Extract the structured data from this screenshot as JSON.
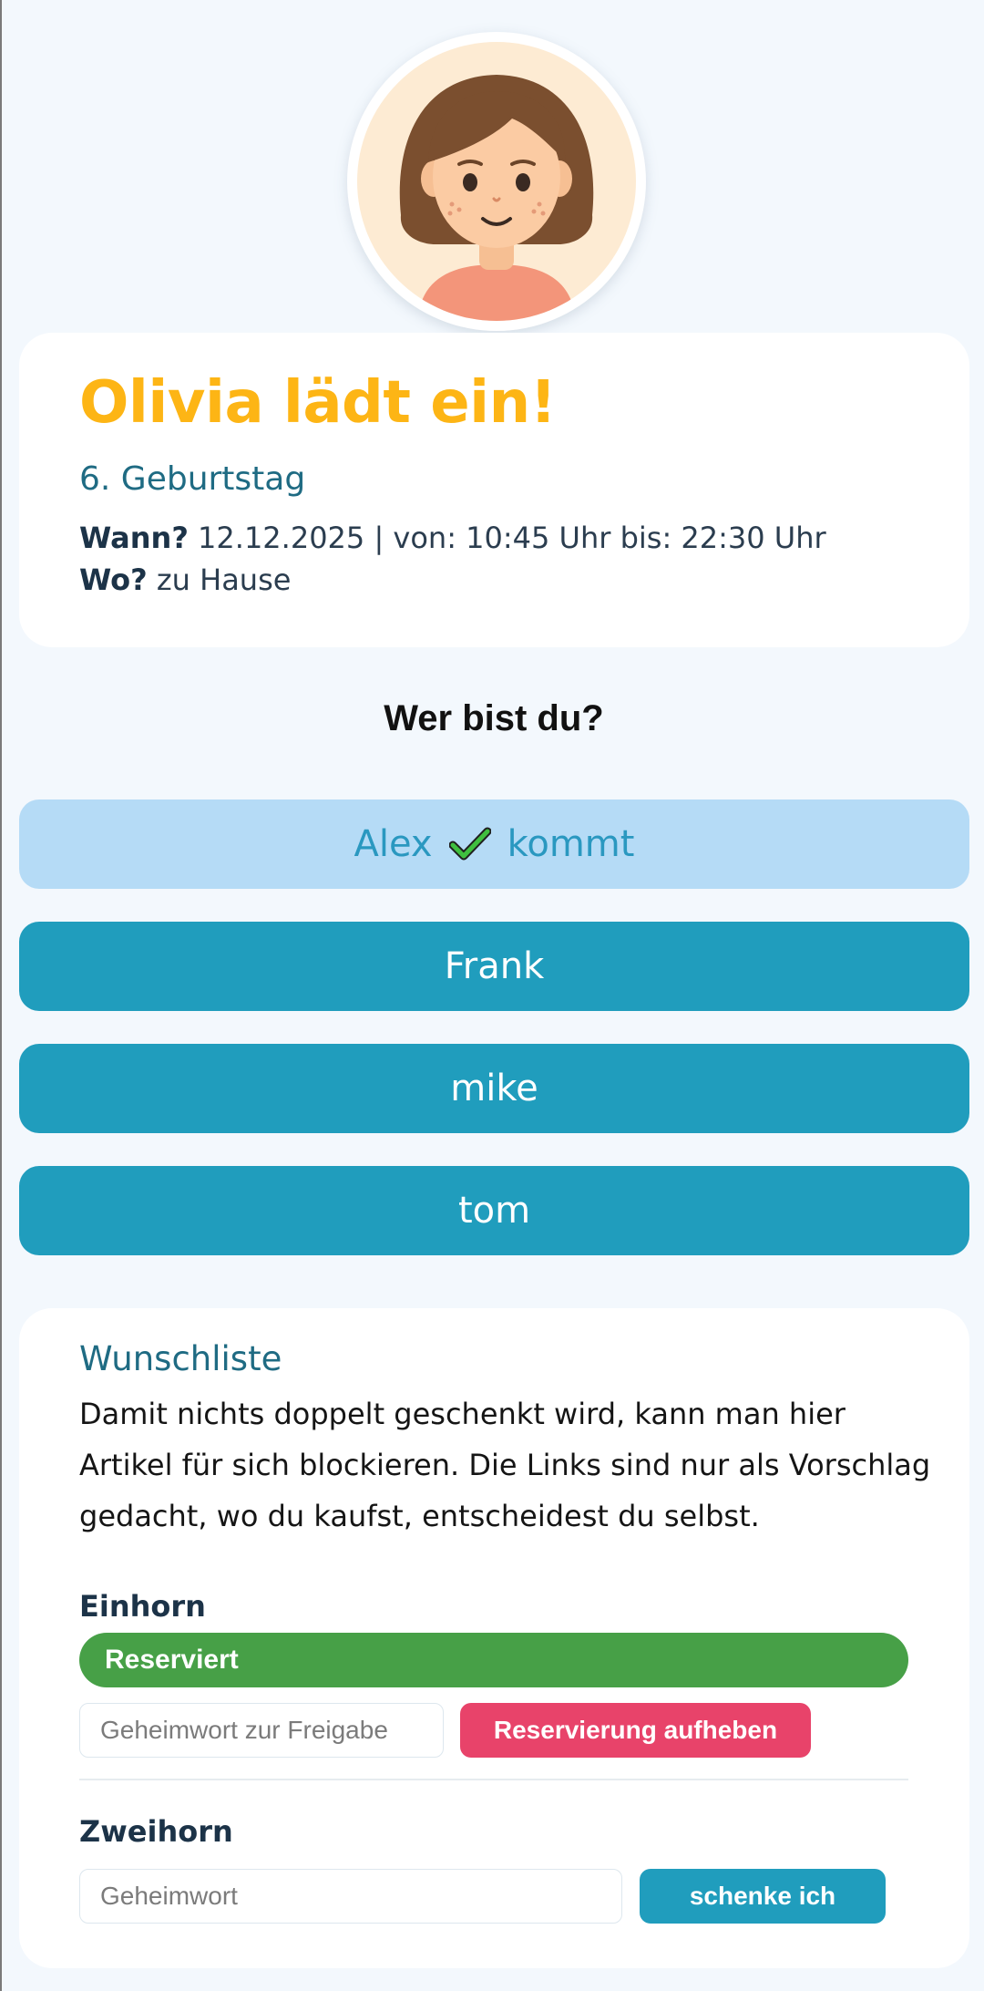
{
  "invite": {
    "title": "Olivia lädt ein!",
    "subtitle": "6. Geburtstag",
    "when_label": "Wann?",
    "when_value": "12.12.2025 | von: 10:45 Uhr bis: 22:30 Uhr",
    "where_label": "Wo?",
    "where_value": "zu Hause"
  },
  "avatar": {
    "icon": "girl-avatar-icon"
  },
  "who_heading": "Wer bist du?",
  "guests": [
    {
      "name": "Alex",
      "status": "kommt",
      "confirmed": true
    },
    {
      "name": "Frank"
    },
    {
      "name": "mike"
    },
    {
      "name": "tom"
    }
  ],
  "wishlist": {
    "title": "Wunschliste",
    "description": "Damit nichts doppelt geschenkt wird, kann man hier Artikel für sich blockieren. Die Links sind nur als Vorschlag gedacht, wo du kaufst, entscheidest du selbst.",
    "items": [
      {
        "name": "Einhorn",
        "status": "Reserviert",
        "input_placeholder": "Geheimwort zur Freigabe",
        "button_label": "Reservierung aufheben"
      },
      {
        "name": "Zweihorn",
        "input_placeholder": "Geheimwort",
        "button_label": "schenke ich"
      }
    ]
  },
  "colors": {
    "background": "#f3f8fd",
    "title": "#fdb515",
    "accent": "#209dbd",
    "confirmed_bg": "#b5dbf6",
    "reserved": "#47a047",
    "release": "#e8436a"
  }
}
